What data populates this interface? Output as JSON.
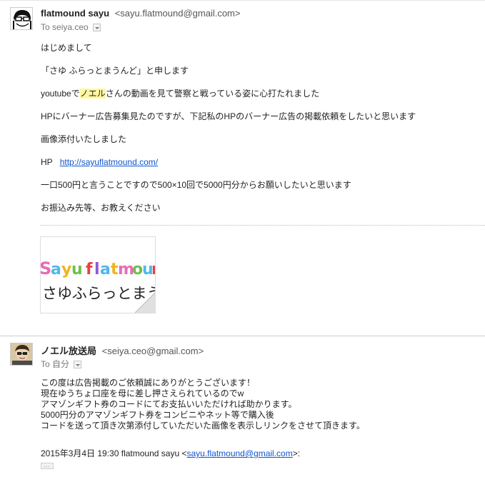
{
  "message1": {
    "sender_name": "flatmound sayu",
    "sender_email": "<sayu.flatmound@gmail.com>",
    "to_label": "To",
    "to_value": "seiya.ceo",
    "p1": "はじめまして",
    "p2": "「さゆ ふらっとまうんど」と申します",
    "p3_a": "youtubeで",
    "p3_hl": "ノエル",
    "p3_b": "さんの動画を見て警察と戦っている姿に心打たれました",
    "p4": "HPにバーナー広告募集見たのですが、下記私のHPのバーナー広告の掲載依頼をしたいと思います",
    "p5": "画像添付いたしました",
    "hp_label": "HP",
    "hp_url": "http://sayuflatmound.com/",
    "p7": "一口500円と言うことですので500×10回で5000円分からお願いしたいと思います",
    "p8": "お振込み先等、お教えください",
    "banner": {
      "line1": "sayu flatmound",
      "line2": "さゆふらっとまうんど"
    }
  },
  "message2": {
    "sender_name": "ノエル放送局",
    "sender_email": "<seiya.ceo@gmail.com>",
    "to_label": "To",
    "to_value": "自分",
    "lines": [
      "この度は広告掲載のご依頼誠にありがとうございます！",
      "現在ゆうちょ口座を母に差し押さえられているのでw",
      "アマゾンギフト券のコードにてお支払いいただければ助かります。",
      "5000円分のアマゾンギフト券をコンビニやネット等で購入後",
      "コードを送って頂き次第添付していただいた画像を表示しリンクをさせて頂きます。"
    ],
    "quote_prefix": "2015年3月4日 19:30 flatmound sayu <",
    "quote_email": "sayu.flatmound@gmail.com",
    "quote_suffix": ">:",
    "ellipsis": "..."
  },
  "colors": {
    "link": "#1155cc",
    "highlight": "#fff7a0"
  }
}
